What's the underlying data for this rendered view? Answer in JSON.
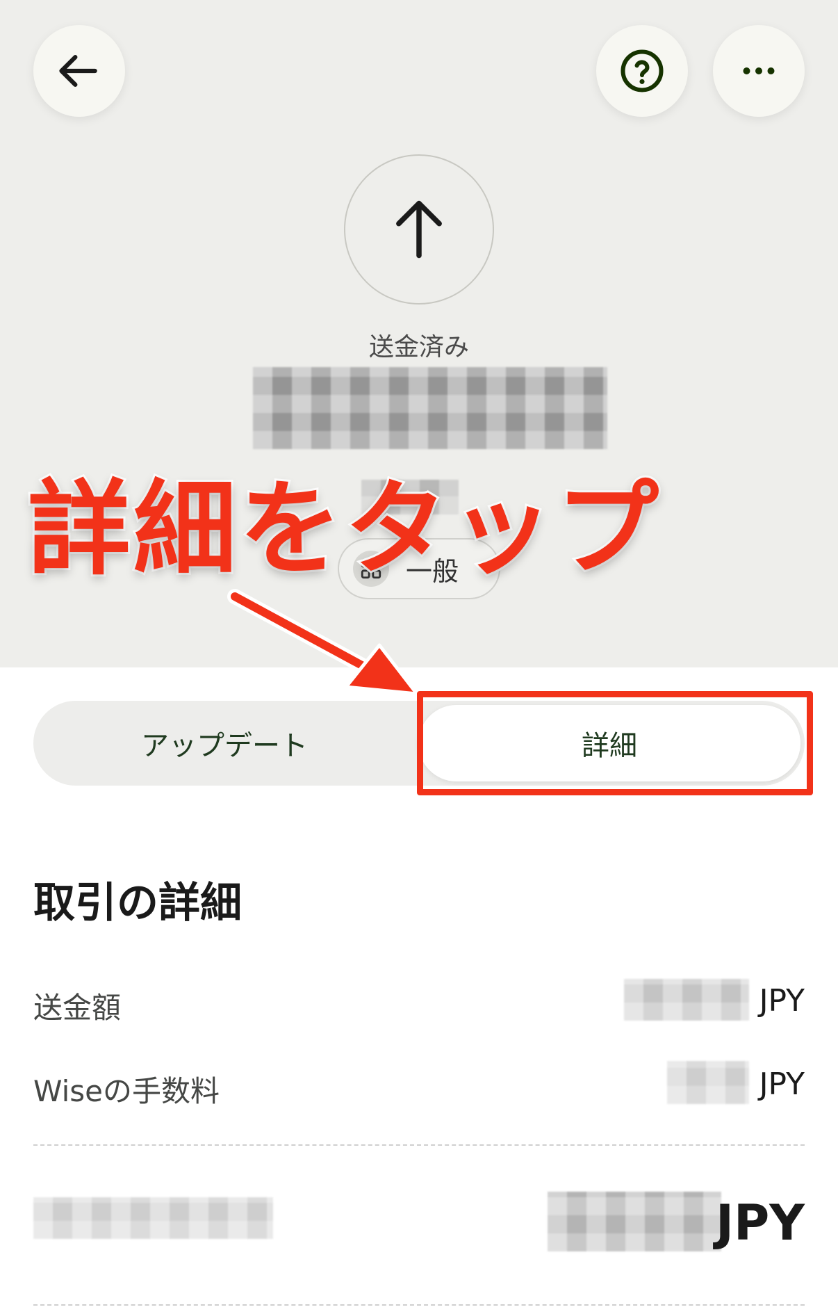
{
  "header": {
    "back_icon": "arrow-left-icon",
    "help_icon": "question-circle-icon",
    "more_icon": "more-horizontal-icon"
  },
  "status": {
    "icon": "arrow-up-icon",
    "label": "送金済み"
  },
  "category": {
    "icon": "category-grid-icon",
    "label": "一般"
  },
  "annotation": {
    "text": "詳細をタップ",
    "color": "#f23219"
  },
  "tabs": [
    {
      "label": "アップデート"
    },
    {
      "label": "詳細"
    }
  ],
  "details": {
    "title": "取引の詳細",
    "rows": [
      {
        "label": "送金額",
        "currency": "JPY"
      },
      {
        "label": "Wiseの手数料",
        "currency": "JPY"
      }
    ],
    "total_currency": "JPY"
  }
}
